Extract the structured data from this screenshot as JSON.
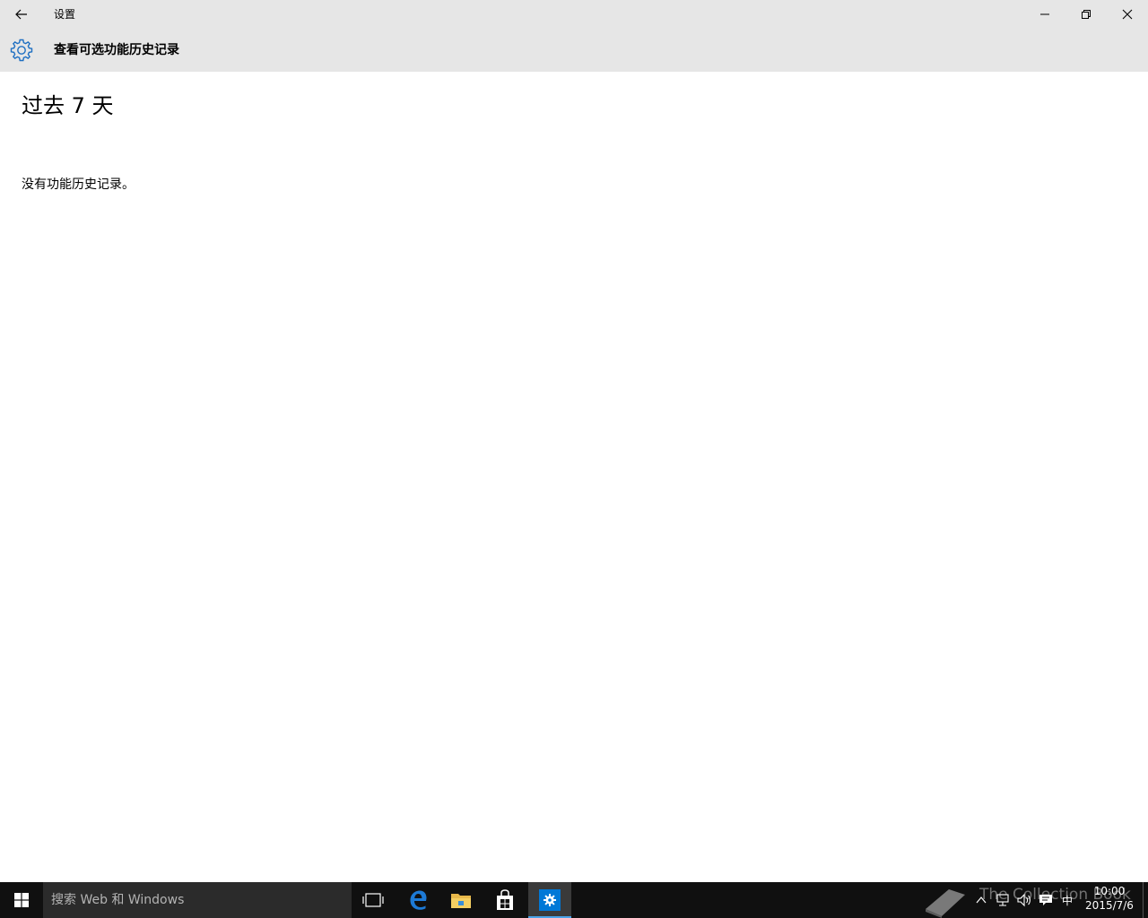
{
  "window": {
    "title": "设置"
  },
  "header": {
    "page_title": "查看可选功能历史记录"
  },
  "content": {
    "section_title": "过去 7 天",
    "empty_message": "没有功能历史记录。"
  },
  "taskbar": {
    "search_placeholder": "搜索 Web 和 Windows",
    "ime_label": "中",
    "clock_time": "10:00",
    "clock_date": "2015/7/6",
    "watermark": "The Collection Book",
    "pinned": [
      "task-view",
      "edge",
      "file-explorer",
      "store",
      "settings"
    ],
    "active_app": "settings"
  },
  "colors": {
    "title_bar": "#e6e6e6",
    "accent": "#0078d7",
    "taskbar": "#101010"
  }
}
